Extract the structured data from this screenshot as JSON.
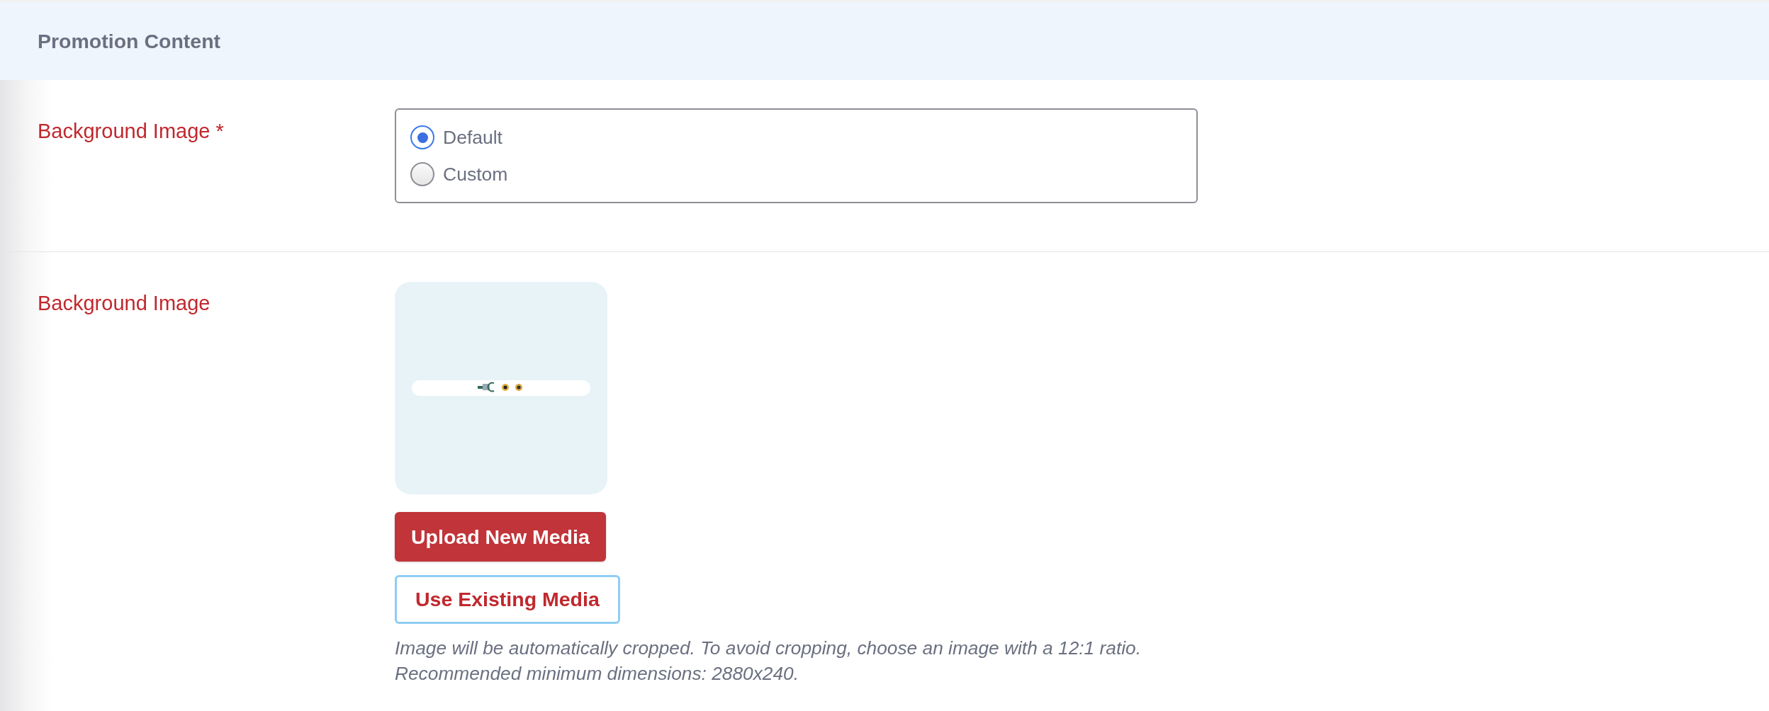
{
  "section": {
    "title": "Promotion Content"
  },
  "fields": [
    {
      "kind": "radio",
      "label": "Background Image",
      "required_mark": "*",
      "options": [
        {
          "label": "Default",
          "selected": true
        },
        {
          "label": "Custom",
          "selected": false
        }
      ]
    },
    {
      "kind": "media",
      "label": "Background Image",
      "buttons": [
        {
          "kind": "primary",
          "label": "Upload New Media"
        },
        {
          "kind": "outline",
          "label": "Use Existing Media"
        }
      ],
      "help": [
        "Image will be automatically cropped. To avoid cropping, choose an image with a 12:1 ratio.",
        "Recommended minimum dimensions: 2880x240."
      ]
    }
  ]
}
